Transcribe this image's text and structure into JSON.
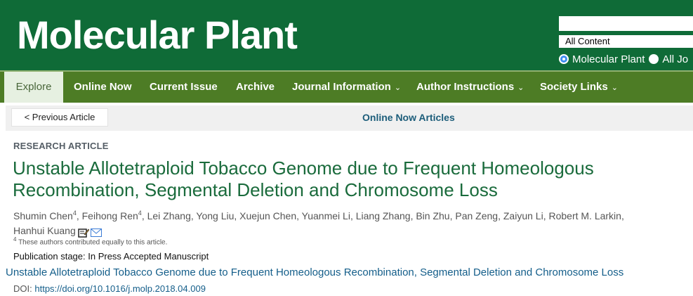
{
  "header": {
    "logo": "Molecular Plant",
    "search_value": "",
    "search_scope_selected": "All Content",
    "scope_options": [
      {
        "label": "Molecular Plant",
        "checked": true
      },
      {
        "label": "All Jo",
        "checked": false
      }
    ],
    "colors": {
      "header_bg": "#0f6b37",
      "nav_bg": "#4d7c25",
      "title_green": "#1a6b3c",
      "link_blue": "#145e8a"
    }
  },
  "nav": {
    "items": [
      {
        "label": "Explore",
        "has_dropdown": false
      },
      {
        "label": "Online Now",
        "has_dropdown": false
      },
      {
        "label": "Current Issue",
        "has_dropdown": false
      },
      {
        "label": "Archive",
        "has_dropdown": false
      },
      {
        "label": "Journal Information",
        "has_dropdown": true
      },
      {
        "label": "Author Instructions",
        "has_dropdown": true
      },
      {
        "label": "Society Links",
        "has_dropdown": true
      }
    ],
    "dropdown_caret": "⌄"
  },
  "subbar": {
    "prev_label": "< Previous Article",
    "section_title": "Online Now Articles"
  },
  "article": {
    "type": "RESEARCH ARTICLE",
    "title": "Unstable Allotetraploid Tobacco Genome due to Frequent Homeologous Recombination, Segmental Deletion and Chromosome Loss",
    "authors": [
      {
        "name": "Shumin Chen",
        "sup": "4"
      },
      {
        "name": "Feihong Ren",
        "sup": "4"
      },
      {
        "name": "Lei Zhang",
        "sup": ""
      },
      {
        "name": "Yong Liu",
        "sup": ""
      },
      {
        "name": "Xuejun Chen",
        "sup": ""
      },
      {
        "name": "Yuanmei Li",
        "sup": ""
      },
      {
        "name": "Liang Zhang",
        "sup": ""
      },
      {
        "name": "Bin Zhu",
        "sup": ""
      },
      {
        "name": "Pan Zeng",
        "sup": ""
      },
      {
        "name": "Zaiyun Li",
        "sup": ""
      },
      {
        "name": "Robert M. Larkin",
        "sup": ""
      },
      {
        "name": "Hanhui Kuang",
        "sup": ""
      }
    ],
    "footnote_mark": "4",
    "footnote_text": "These authors contributed equally to this article.",
    "publication_stage": "Publication stage: In Press Accepted Manuscript",
    "pdf_link_text": "Unstable Allotetraploid Tobacco Genome due to Frequent Homeologous Recombination, Segmental Deletion and Chromosome Loss",
    "doi_label": "DOI:",
    "doi_url": "https://doi.org/10.1016/j.molp.2018.04.009"
  }
}
